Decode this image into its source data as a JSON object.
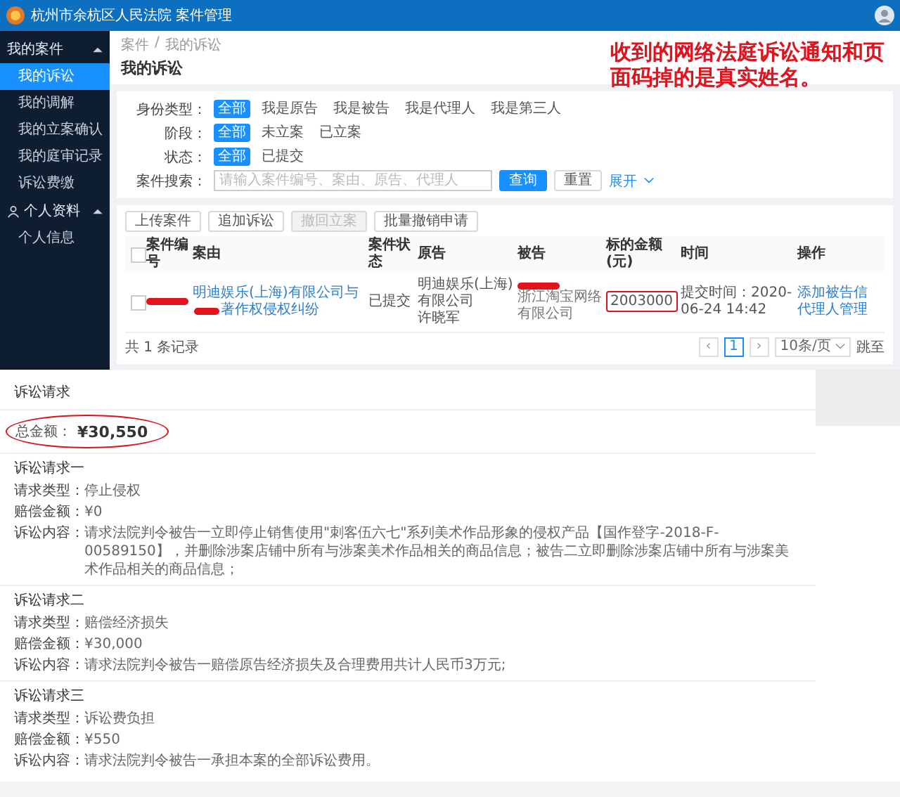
{
  "header": {
    "title": "杭州市余杭区人民法院 案件管理"
  },
  "sidebar": {
    "groups": [
      {
        "label": "我的案件",
        "expanded": true,
        "icon": false,
        "items": [
          {
            "label": "我的诉讼",
            "selected": true
          },
          {
            "label": "我的调解",
            "selected": false
          },
          {
            "label": "我的立案确认",
            "selected": false
          },
          {
            "label": "我的庭审记录",
            "selected": false
          },
          {
            "label": "诉讼费缴",
            "selected": false
          }
        ]
      },
      {
        "label": "个人资料",
        "expanded": true,
        "icon": true,
        "items": [
          {
            "label": "个人信息",
            "selected": false
          }
        ]
      }
    ]
  },
  "breadcrumb": {
    "items": [
      "案件",
      "我的诉讼"
    ],
    "separator": "/"
  },
  "page_title": "我的诉讼",
  "annotation": "收到的网络法庭诉讼通知和页面码掉的是真实姓名。",
  "filters": [
    {
      "label": "身份类型：",
      "options": [
        {
          "label": "全部",
          "selected": true
        },
        {
          "label": "我是原告",
          "selected": false
        },
        {
          "label": "我是被告",
          "selected": false
        },
        {
          "label": "我是代理人",
          "selected": false
        },
        {
          "label": "我是第三人",
          "selected": false
        }
      ]
    },
    {
      "label": "阶段：",
      "options": [
        {
          "label": "全部",
          "selected": true
        },
        {
          "label": "未立案",
          "selected": false
        },
        {
          "label": "已立案",
          "selected": false
        }
      ]
    },
    {
      "label": "状态：",
      "options": [
        {
          "label": "全部",
          "selected": true
        },
        {
          "label": "已提交",
          "selected": false
        }
      ]
    }
  ],
  "search": {
    "label": "案件搜索：",
    "placeholder": "请输入案件编号、案由、原告、代理人",
    "query_button": "查询",
    "reset_button": "重置",
    "expand": "展开"
  },
  "table": {
    "actions": [
      {
        "label": "上传案件",
        "disabled": false
      },
      {
        "label": "追加诉讼",
        "disabled": false
      },
      {
        "label": "撤回立案",
        "disabled": true
      },
      {
        "label": "批量撤销申请",
        "disabled": false
      }
    ],
    "columns": [
      "案件编号",
      "案由",
      "案件状态",
      "原告",
      "被告",
      "标的金额(元)",
      "时间",
      "操作"
    ],
    "rows": [
      {
        "selected": false,
        "case_no_redacted": true,
        "cause_before": "明迪娱乐(上海)有限公司与",
        "cause_redacted": true,
        "cause_after": "著作权侵权纠纷",
        "status": "已提交",
        "plaintiff": [
          "明迪娱乐(上海)有限公司",
          "许晓军"
        ],
        "defendant_redacted": true,
        "defendant": "浙江淘宝网络有限公司",
        "amount": "2003000",
        "amount_circled": true,
        "time": "提交时间：2020-06-24 14:42",
        "operations": [
          "添加被告信",
          "代理人管理"
        ]
      }
    ],
    "header_checked": false,
    "total": "共 1 条记录",
    "prev": "‹",
    "pages": [
      {
        "label": "1",
        "selected": true
      }
    ],
    "next": "›",
    "page_size": "10条/页",
    "jump": "跳至"
  },
  "claims": {
    "title": "诉讼请求",
    "total_label": "总金额：",
    "total_value": "¥30,550",
    "total_circled": true,
    "items": [
      {
        "title": "诉讼请求一",
        "fields": [
          {
            "label": "请求类型：",
            "value": "停止侵权"
          },
          {
            "label": "赔偿金额：",
            "value": "¥0"
          },
          {
            "label": "诉讼内容：",
            "value": "请求法院判令被告一立即停止销售使用\"刺客伍六七\"系列美术作品形象的侵权产品【国作登字-2018-F-00589150】，并删除涉案店铺中所有与涉案美术作品相关的商品信息；被告二立即删除涉案店铺中所有与涉案美术作品相关的商品信息；"
          }
        ]
      },
      {
        "title": "诉讼请求二",
        "fields": [
          {
            "label": "请求类型：",
            "value": "赔偿经济损失"
          },
          {
            "label": "赔偿金额：",
            "value": "¥30,000"
          },
          {
            "label": "诉讼内容：",
            "value": "请求法院判令被告一赔偿原告经济损失及合理费用共计人民币3万元;"
          }
        ]
      },
      {
        "title": "诉讼请求三",
        "fields": [
          {
            "label": "请求类型：",
            "value": "诉讼费负担"
          },
          {
            "label": "赔偿金额：",
            "value": "¥550"
          },
          {
            "label": "诉讼内容：",
            "value": "请求法院判令被告一承担本案的全部诉讼费用。"
          }
        ]
      }
    ]
  }
}
